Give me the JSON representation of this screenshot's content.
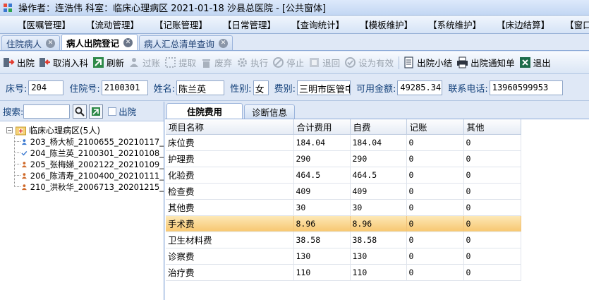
{
  "window": {
    "title": "操作者：连浩伟  科室：临床心理病区  2021-01-18  沙县总医院 - [公共窗体]"
  },
  "menu": [
    {
      "label": "【医嘱管理】"
    },
    {
      "label": "【流动管理】"
    },
    {
      "label": "【记账管理】"
    },
    {
      "label": "【日常管理】"
    },
    {
      "label": "【查询统计】"
    },
    {
      "label": "【模板维护】"
    },
    {
      "label": "【系统维护】"
    },
    {
      "label": "【床边结算】"
    },
    {
      "label": "【窗口】"
    }
  ],
  "doc_tabs": [
    {
      "label": "住院病人",
      "active": false
    },
    {
      "label": "病人出院登记",
      "active": true
    },
    {
      "label": "病人汇总清单查询",
      "active": false
    }
  ],
  "toolbar": {
    "discharge": "出院",
    "cancel_admission": "取消入科",
    "refresh": "刷新",
    "post": "过账",
    "extract": "提取",
    "discard": "废弃",
    "execute": "执行",
    "stop": "停止",
    "return": "退回",
    "set_valid": "设为有效",
    "summary": "出院小结",
    "notice": "出院通知单",
    "exit": "退出"
  },
  "info": {
    "bed_label": "床号:",
    "bed": "204",
    "admission_label": "住院号:",
    "admission": "2100301",
    "name_label": "姓名:",
    "name": "陈兰英",
    "sex_label": "性别:",
    "sex": "女",
    "fee_type_label": "费别:",
    "fee_type": "三明市医管中",
    "balance_label": "可用金额:",
    "balance": "49285.34",
    "phone_label": "联系电话:",
    "phone": "13960599953"
  },
  "search": {
    "label": "搜索:",
    "discharged_label": "出院"
  },
  "tree": {
    "root": "临床心理病区(5人)",
    "patients": [
      {
        "label": "203_杨大桢_2100655_20210117_",
        "icon": "male-person-icon",
        "color": "#3a78d0"
      },
      {
        "label": "204_陈兰英_2100301_20210108_",
        "icon": "check-icon",
        "color": "#3a78d0"
      },
      {
        "label": "205_张梅娣_2002122_20210109_",
        "icon": "female-person-icon",
        "color": "#d06a2a"
      },
      {
        "label": "206_陈清寿_2100400_20210111_",
        "icon": "male-person-icon",
        "color": "#d06a2a"
      },
      {
        "label": "210_洪秋华_2006713_20201215_",
        "icon": "female-person-icon",
        "color": "#d06a2a"
      }
    ]
  },
  "sub_tabs": [
    {
      "label": "住院费用",
      "active": true
    },
    {
      "label": "诊断信息",
      "active": false
    }
  ],
  "grid": {
    "columns": [
      "项目名称",
      "合计费用",
      "自费",
      "记账",
      "其他"
    ],
    "rows": [
      {
        "cells": [
          "床位费",
          "184.04",
          "184.04",
          "0",
          "0"
        ],
        "selected": false
      },
      {
        "cells": [
          "护理费",
          "290",
          "290",
          "0",
          "0"
        ],
        "selected": false
      },
      {
        "cells": [
          "化验费",
          "464.5",
          "464.5",
          "0",
          "0"
        ],
        "selected": false
      },
      {
        "cells": [
          "检查费",
          "409",
          "409",
          "0",
          "0"
        ],
        "selected": false
      },
      {
        "cells": [
          "其他费",
          "30",
          "30",
          "0",
          "0"
        ],
        "selected": false
      },
      {
        "cells": [
          "手术费",
          "8.96",
          "8.96",
          "0",
          "0"
        ],
        "selected": true
      },
      {
        "cells": [
          "卫生材料费",
          "38.58",
          "38.58",
          "0",
          "0"
        ],
        "selected": false
      },
      {
        "cells": [
          "诊察费",
          "130",
          "130",
          "0",
          "0"
        ],
        "selected": false
      },
      {
        "cells": [
          "治疗费",
          "110",
          "110",
          "0",
          "0"
        ],
        "selected": false
      }
    ]
  }
}
